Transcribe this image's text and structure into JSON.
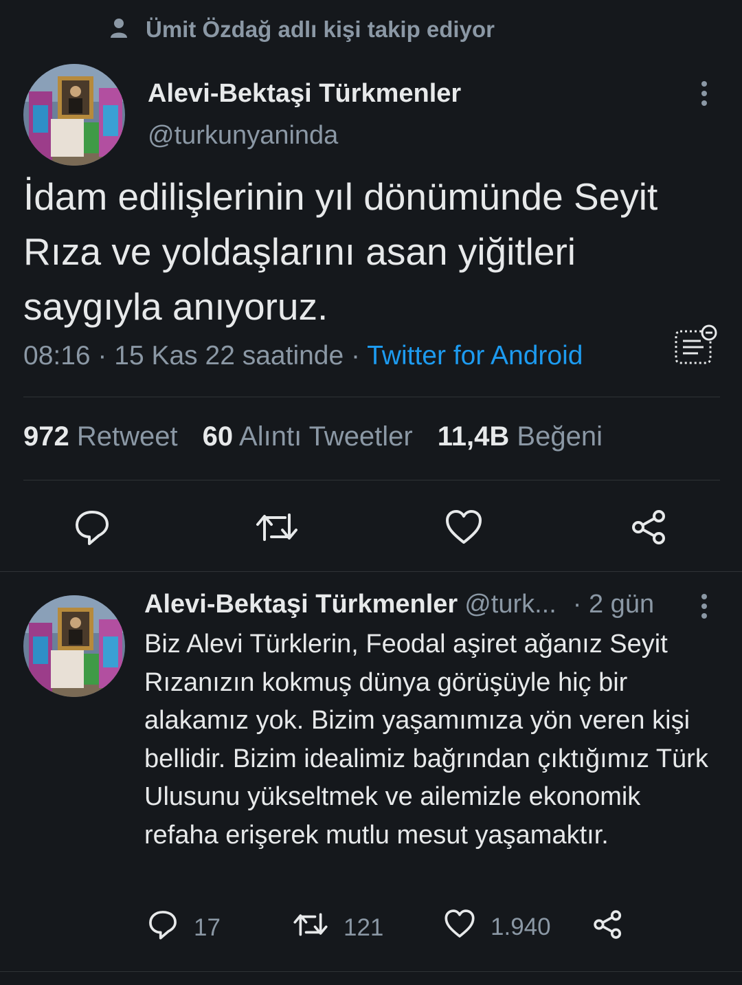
{
  "social_context": {
    "text": "Ümit Özdağ adlı kişi takip ediyor",
    "icon": "person-icon"
  },
  "tweet": {
    "author_name": "Alevi-Bektaşi Türkmenler",
    "author_handle": "@turkunyaninda",
    "text": "İdam edilişlerinin yıl dönümünde Seyit Rıza ve yoldaşlarını asan yiğitleri saygıyla anıyoruz.",
    "time": "08:16 · 15 Kas 22 saatinde · ",
    "source": "Twitter for Android",
    "stats": {
      "retweets_count": "972",
      "retweets_label": "Retweet",
      "quotes_count": "60",
      "quotes_label": "Alıntı Tweetler",
      "likes_count": "11,4B",
      "likes_label": "Beğeni"
    }
  },
  "reply": {
    "author_name": "Alevi-Bektaşi Türkmenler",
    "author_handle": "@turk...",
    "age": "· 2 gün",
    "text": "Biz Alevi Türklerin, Feodal aşiret ağanız Seyit Rızanızın kokmuş dünya görüşüyle hiç bir alakamız yok. Bizim yaşamımıza yön veren kişi bellidir. Bizim idealimiz bağrından çıktığımız Türk Ulusunu yükseltmek ve ailemizle ekonomik refaha erişerek mutlu mesut yaşamaktır.",
    "replies": "17",
    "retweets": "121",
    "likes": "1.940"
  },
  "colors": {
    "background": "#15181c",
    "text": "#e7e9ea",
    "muted": "#8b98a5",
    "link": "#1d9bf0",
    "divider": "#2f3336"
  }
}
